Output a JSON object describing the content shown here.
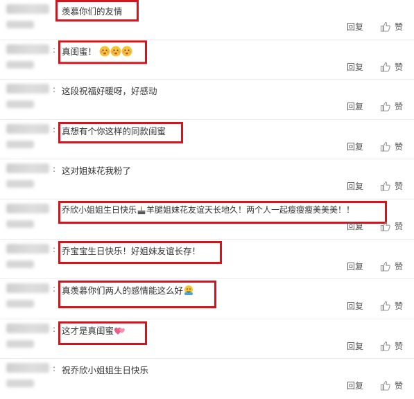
{
  "actions": {
    "reply_label": "回复",
    "like_label": "赞"
  },
  "comments": [
    {
      "text": "羡慕你们的友情",
      "highlighted": true
    },
    {
      "text": "真闺蜜！",
      "emoji": [
        "face",
        "face",
        "face"
      ],
      "highlighted": true
    },
    {
      "text": "这段祝福好暖呀，好感动",
      "highlighted": false
    },
    {
      "text": "真想有个你这样的同款闺蜜",
      "highlighted": true
    },
    {
      "text": "这对姐妹花我粉了",
      "highlighted": false
    },
    {
      "text": "乔欣小姐姐生日快乐",
      "emoji_mid": "cake",
      "text2": "羊腿姐妹花友谊天长地久！两个人一起瘦瘦瘦美美美！！",
      "highlighted": true
    },
    {
      "text": "乔宝宝生日快乐！好姐妹友谊长存！",
      "highlighted": true
    },
    {
      "text": "真羡慕你们两人的感情能这么好",
      "emoji": [
        "hug"
      ],
      "highlighted": true
    },
    {
      "text": "这才是真闺蜜",
      "emoji": [
        "heart"
      ],
      "highlighted": true
    },
    {
      "text": "祝乔欣小姐姐生日快乐",
      "highlighted": false
    }
  ]
}
